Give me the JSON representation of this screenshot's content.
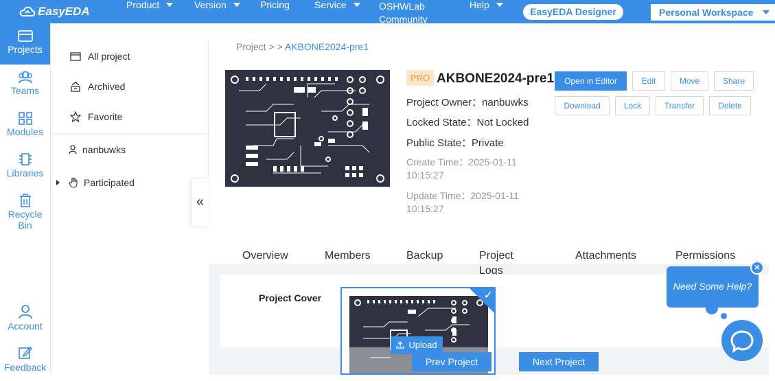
{
  "topbar": {
    "logo_text": "EasyEDA",
    "nav": [
      {
        "label": "Product",
        "has_caret": true
      },
      {
        "label": "Version",
        "has_caret": true
      },
      {
        "label": "Pricing",
        "has_caret": false
      },
      {
        "label": "Service",
        "has_caret": true
      },
      {
        "label": "OSHWLab Community",
        "has_caret": false
      },
      {
        "label": "Help",
        "has_caret": true
      }
    ],
    "designer_button": "EasyEDA Designer",
    "workspace": "Personal Workspace"
  },
  "leftbar": {
    "items": [
      {
        "label": "Projects",
        "icon": "folder-icon",
        "active": true
      },
      {
        "label": "Teams",
        "icon": "users-icon"
      },
      {
        "label": "Modules",
        "icon": "grid-icon"
      },
      {
        "label": "Libraries",
        "icon": "chip-icon"
      },
      {
        "label": "Recycle Bin",
        "icon": "trash-icon"
      },
      {
        "label": "Account",
        "icon": "user-icon"
      },
      {
        "label": "Feedback",
        "icon": "edit-icon"
      }
    ]
  },
  "subnav": {
    "items": [
      {
        "label": "All project",
        "icon": "folder-icon"
      },
      {
        "label": "Archived",
        "icon": "archive-icon"
      },
      {
        "label": "Favorite",
        "icon": "star-icon"
      },
      {
        "label": "nanbuwks",
        "icon": "user-icon"
      },
      {
        "label": "Participated",
        "icon": "hand-icon"
      }
    ],
    "collapse_label": "«"
  },
  "breadcrumb": {
    "root": "Project",
    "sep1": ">",
    "sep2": ">",
    "current": "AKBONE2024-pre1"
  },
  "project": {
    "badge": "PRO",
    "title": "AKBONE2024-pre1",
    "owner": "Project Owner：nanbuwks",
    "locked": "Locked State：Not Locked",
    "public": "Public State：Private",
    "create_time": "Create Time：2025-01-11 10:15:27",
    "update_time": "Update Time：2025-01-11 10:15:27"
  },
  "actions": {
    "open_editor": "Open in Editor",
    "edit": "Edit",
    "move": "Move",
    "share": "Share",
    "download": "Download",
    "lock": "Lock",
    "transfer": "Transfer",
    "delete": "Delete"
  },
  "tabs": [
    {
      "label": "Overview"
    },
    {
      "label": "Members"
    },
    {
      "label": "Backup"
    },
    {
      "label": "Project Logs"
    },
    {
      "label": "Attachments"
    },
    {
      "label": "Permissions"
    }
  ],
  "cover": {
    "label": "Project Cover",
    "upload": "Upload",
    "checkmark": "✓"
  },
  "pager": {
    "prev": "Prev Project",
    "next": "Next Project"
  },
  "help": {
    "bubble": "Need Some Help?",
    "close": "×"
  },
  "colors": {
    "brand": "#3a8ee6",
    "pcb": "#303141",
    "pro_bg": "#fde6c8",
    "pro_text": "#e6a23c"
  }
}
